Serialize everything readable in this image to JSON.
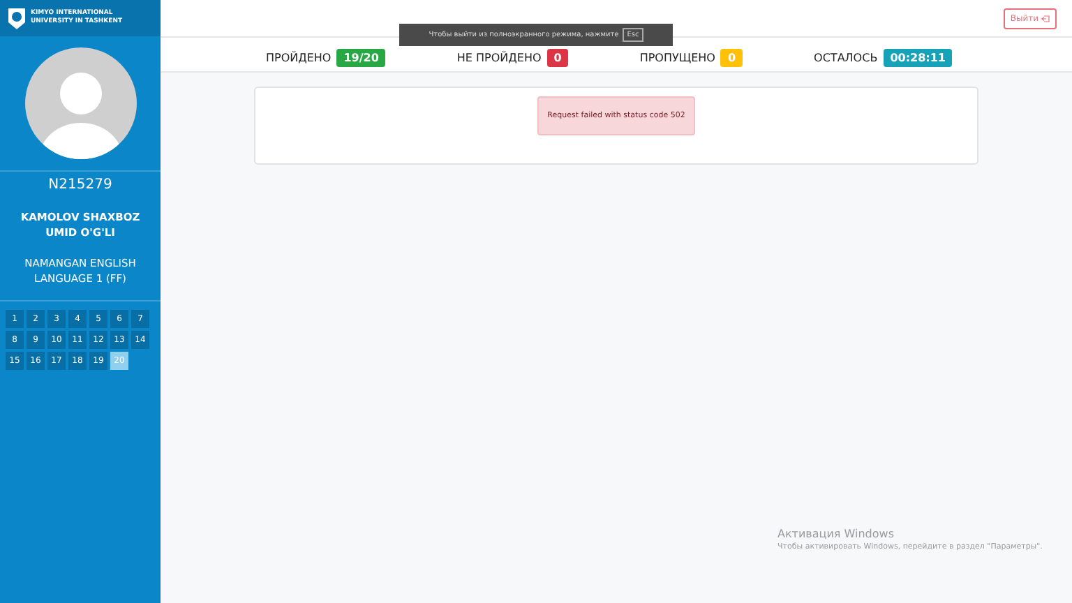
{
  "logo": {
    "title": "KIMYO INTERNATIONAL UNIVERSITY IN TASHKENT"
  },
  "student": {
    "id": "N215279",
    "name": "KAMOLOV SHAXBOZ UMID O'G'LI",
    "group": "NAMANGAN ENGLISH LANGUAGE 1 (FF)"
  },
  "questions": [
    {
      "label": "1",
      "selected": false
    },
    {
      "label": "2",
      "selected": false
    },
    {
      "label": "3",
      "selected": false
    },
    {
      "label": "4",
      "selected": false
    },
    {
      "label": "5",
      "selected": false
    },
    {
      "label": "6",
      "selected": false
    },
    {
      "label": "7",
      "selected": false
    },
    {
      "label": "8",
      "selected": false
    },
    {
      "label": "9",
      "selected": false
    },
    {
      "label": "10",
      "selected": false
    },
    {
      "label": "11",
      "selected": false
    },
    {
      "label": "12",
      "selected": false
    },
    {
      "label": "13",
      "selected": false
    },
    {
      "label": "14",
      "selected": false
    },
    {
      "label": "15",
      "selected": false
    },
    {
      "label": "16",
      "selected": false
    },
    {
      "label": "17",
      "selected": false
    },
    {
      "label": "18",
      "selected": false
    },
    {
      "label": "19",
      "selected": false
    },
    {
      "label": "20",
      "selected": true
    }
  ],
  "logout_button": "Выйти",
  "stats": [
    {
      "label": "ПРОЙДЕНО",
      "value": "19/20",
      "color": "#28a745"
    },
    {
      "label": "НЕ ПРОЙДЕНО",
      "value": "0",
      "color": "#dc3545"
    },
    {
      "label": "ПРОПУЩЕНО",
      "value": "0",
      "color": "#ffc107"
    },
    {
      "label": "ОСТАЛОСЬ",
      "value": "00:28:11",
      "color": "#17a2b8"
    }
  ],
  "error_message": "Request failed with status code 502",
  "fullscreen_toast": {
    "text": "Чтобы выйти из полноэкранного режима, нажмите",
    "key": "Esc"
  },
  "activation": {
    "title": "Активация Windows",
    "text": "Чтобы активировать Windows, перейдите в раздел \"Параметры\"."
  }
}
